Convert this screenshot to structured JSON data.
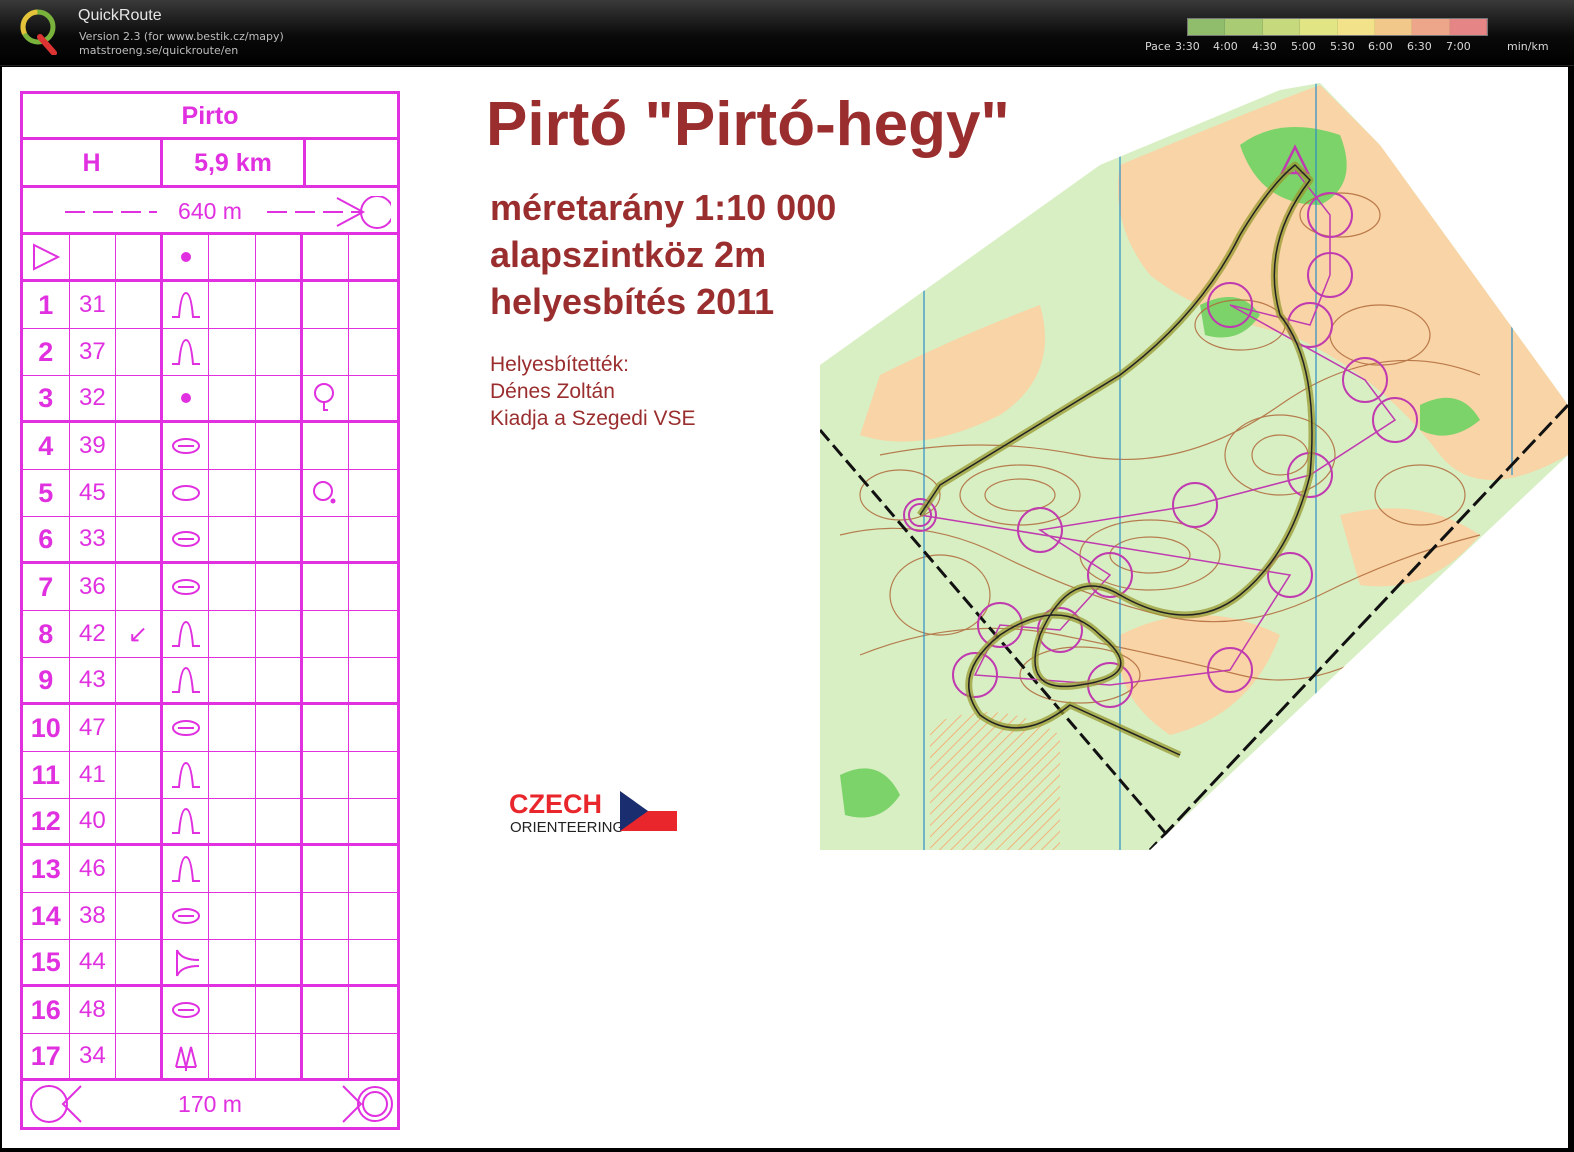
{
  "app": {
    "title": "QuickRoute",
    "version": "Version 2.3  (for www.bestik.cz/mapy)",
    "url": "matstroeng.se/quickroute/en",
    "logo_letter": "Q"
  },
  "pace_legend": {
    "prefix": "Pace",
    "ticks": [
      "3:30",
      "4:00",
      "4:30",
      "5:00",
      "5:30",
      "6:00",
      "6:30",
      "7:00"
    ],
    "unit": "min/km",
    "colors": [
      "#8fbd6c",
      "#a9cb74",
      "#c6d97c",
      "#e2e584",
      "#f2e28a",
      "#f1c88a",
      "#eea68a",
      "#e68585"
    ]
  },
  "description_sheet": {
    "event": "Pirto",
    "category": "H",
    "length": "5,9 km",
    "start_distance": "640 m",
    "finish_distance": "170 m",
    "controls": [
      {
        "num": "1",
        "code": "31",
        "symbol": "knoll"
      },
      {
        "num": "2",
        "code": "37",
        "symbol": "knoll"
      },
      {
        "num": "3",
        "code": "32",
        "symbol": "dot",
        "detail": "tree"
      },
      {
        "num": "4",
        "code": "39",
        "symbol": "depression"
      },
      {
        "num": "5",
        "code": "45",
        "symbol": "ellipse",
        "detail": "boulder"
      },
      {
        "num": "6",
        "code": "33",
        "symbol": "depression"
      },
      {
        "num": "7",
        "code": "36",
        "symbol": "depression"
      },
      {
        "num": "8",
        "code": "42",
        "symbol": "knoll",
        "direction": "↙"
      },
      {
        "num": "9",
        "code": "43",
        "symbol": "knoll"
      },
      {
        "num": "10",
        "code": "47",
        "symbol": "depression"
      },
      {
        "num": "11",
        "code": "41",
        "symbol": "knoll"
      },
      {
        "num": "12",
        "code": "40",
        "symbol": "knoll"
      },
      {
        "num": "13",
        "code": "46",
        "symbol": "knoll"
      },
      {
        "num": "14",
        "code": "38",
        "symbol": "depression"
      },
      {
        "num": "15",
        "code": "44",
        "symbol": "spur"
      },
      {
        "num": "16",
        "code": "48",
        "symbol": "depression"
      },
      {
        "num": "17",
        "code": "34",
        "symbol": "tree"
      }
    ]
  },
  "map": {
    "title": "Pirtó \"Pirtó-hegy\"",
    "scale": "méretarány 1:10 000",
    "contour": "alapszintköz 2m",
    "revision": "helyesbítés 2011",
    "credits_label": "Helyesbítették:",
    "credits_name": "Dénes Zoltán",
    "publisher": "Kiadja a Szegedi VSE"
  },
  "sponsor": {
    "word1": "CZECH",
    "word2": "ORIENTEERING"
  },
  "colors": {
    "magenta": "#e030e0",
    "title_red": "#9a2d2d",
    "czech_red": "#e8262b"
  }
}
